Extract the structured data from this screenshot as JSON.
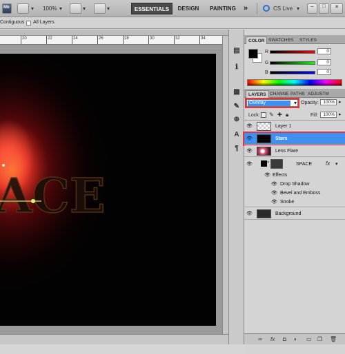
{
  "appbar": {
    "logo": "Mb",
    "zoom": "100%",
    "workspaces": [
      "ESSENTIALS",
      "DESIGN",
      "PAINTING"
    ],
    "more": "»",
    "cslive": "CS Live",
    "window_controls": [
      "–",
      "□",
      "✕"
    ]
  },
  "options": {
    "contiguous_label": "Contiguous",
    "all_layers_label": "All Layers"
  },
  "ruler": {
    "numbers": [
      "20",
      "22",
      "24",
      "26",
      "28",
      "30",
      "32",
      "34"
    ]
  },
  "color_panel": {
    "tabs": [
      "COLOR",
      "SWATCHES",
      "STYLES"
    ],
    "channels": [
      {
        "label": "R",
        "value": "0",
        "from": "#000000",
        "to": "#ff0000"
      },
      {
        "label": "G",
        "value": "0",
        "from": "#000000",
        "to": "#00ff00"
      },
      {
        "label": "B",
        "value": "0",
        "from": "#000000",
        "to": "#0000ff"
      }
    ]
  },
  "layers_panel": {
    "tabs": [
      "LAYERS",
      "CHANNE",
      "PATHS",
      "ADJUSTM"
    ],
    "blend_mode": "Overlay",
    "opacity_label": "Opacity:",
    "opacity_value": "100%",
    "lock_label": "Lock:",
    "fill_label": "Fill:",
    "fill_value": "100%",
    "layers": [
      {
        "name": "Layer 1",
        "selected": false
      },
      {
        "name": "Stars",
        "selected": true
      },
      {
        "name": "Lens Flare",
        "selected": false
      },
      {
        "name": "SPACE",
        "selected": false,
        "fx": "fx"
      },
      {
        "name": "Effects",
        "selected": false
      },
      {
        "name": "Drop Shadow",
        "selected": false
      },
      {
        "name": "Bevel and Emboss",
        "selected": false
      },
      {
        "name": "Stroke",
        "selected": false
      },
      {
        "name": "Background",
        "selected": false
      }
    ]
  },
  "colors": {
    "selection_highlight": "#e8303a",
    "selected_row": "#3e91f0",
    "canvas": "#020202"
  }
}
